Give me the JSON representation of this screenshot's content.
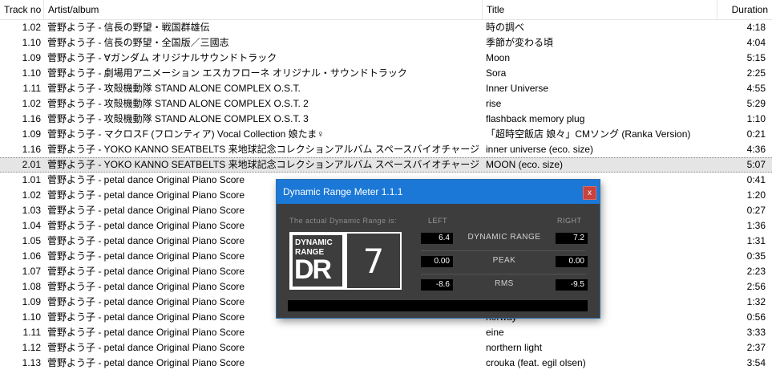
{
  "columns": {
    "track": "Track no",
    "artist": "Artist/album",
    "title": "Title",
    "duration": "Duration"
  },
  "rows": [
    {
      "track": "1.02",
      "artist": "菅野よう子 - 信長の野望・戦国群雄伝",
      "title": "時の調べ",
      "duration": "4:18"
    },
    {
      "track": "1.10",
      "artist": "菅野よう子 - 信長の野望・全国版／三國志",
      "title": "季節が変わる頃",
      "duration": "4:04"
    },
    {
      "track": "1.09",
      "artist": "菅野よう子 - ∀ガンダム オリジナルサウンドトラック",
      "title": "Moon",
      "duration": "5:15"
    },
    {
      "track": "1.10",
      "artist": "菅野よう子 - 劇場用アニメーション エスカフローネ オリジナル・サウンドトラック",
      "title": "Sora",
      "duration": "2:25"
    },
    {
      "track": "1.11",
      "artist": "菅野よう子 - 攻殻機動隊 STAND ALONE COMPLEX O.S.T.",
      "title": "Inner Universe",
      "duration": "4:55"
    },
    {
      "track": "1.02",
      "artist": "菅野よう子 - 攻殻機動隊 STAND ALONE COMPLEX O.S.T. 2",
      "title": "rise",
      "duration": "5:29"
    },
    {
      "track": "1.16",
      "artist": "菅野よう子 - 攻殻機動隊 STAND ALONE COMPLEX O.S.T. 3",
      "title": "flashback memory plug",
      "duration": "1:10"
    },
    {
      "track": "1.09",
      "artist": "菅野よう子 - マクロスF (フロンティア) Vocal Collection 娘たま♀",
      "title": "「超時空飯店 娘々」CMソング (Ranka Version)",
      "duration": "0:21"
    },
    {
      "track": "1.16",
      "artist": "菅野よう子 - YOKO KANNO SEATBELTS 来地球記念コレクションアルバム スペースバイオチャージ",
      "title": "inner universe (eco. size)",
      "duration": "4:36"
    },
    {
      "track": "2.01",
      "artist": "菅野よう子 - YOKO KANNO SEATBELTS 来地球記念コレクションアルバム スペースバイオチャージ",
      "title": "MOON (eco. size)",
      "duration": "5:07",
      "selected": true
    },
    {
      "track": "1.01",
      "artist": "菅野よう子 - petal dance Original Piano Score",
      "title": "",
      "duration": "0:41"
    },
    {
      "track": "1.02",
      "artist": "菅野よう子 - petal dance Original Piano Score",
      "title": "",
      "duration": "1:20"
    },
    {
      "track": "1.03",
      "artist": "菅野よう子 - petal dance Original Piano Score",
      "title": "",
      "duration": "0:27"
    },
    {
      "track": "1.04",
      "artist": "菅野よう子 - petal dance Original Piano Score",
      "title": "",
      "duration": "1:36"
    },
    {
      "track": "1.05",
      "artist": "菅野よう子 - petal dance Original Piano Score",
      "title": "",
      "duration": "1:31"
    },
    {
      "track": "1.06",
      "artist": "菅野よう子 - petal dance Original Piano Score",
      "title": "",
      "duration": "0:35"
    },
    {
      "track": "1.07",
      "artist": "菅野よう子 - petal dance Original Piano Score",
      "title": "",
      "duration": "2:23"
    },
    {
      "track": "1.08",
      "artist": "菅野よう子 - petal dance Original Piano Score",
      "title": "",
      "duration": "2:56"
    },
    {
      "track": "1.09",
      "artist": "菅野よう子 - petal dance Original Piano Score",
      "title": "",
      "duration": "1:32"
    },
    {
      "track": "1.10",
      "artist": "菅野よう子 - petal dance Original Piano Score",
      "title": "norway",
      "duration": "0:56"
    },
    {
      "track": "1.11",
      "artist": "菅野よう子 - petal dance Original Piano Score",
      "title": "eine",
      "duration": "3:33"
    },
    {
      "track": "1.12",
      "artist": "菅野よう子 - petal dance Original Piano Score",
      "title": "northern light",
      "duration": "2:37"
    },
    {
      "track": "1.13",
      "artist": "菅野よう子 - petal dance Original Piano Score",
      "title": "crouka (feat. egil olsen)",
      "duration": "3:54"
    }
  ],
  "dr_window": {
    "title": "Dynamic Range Meter 1.1.1",
    "close_label": "x",
    "subtitle": "The actual Dynamic Range is:",
    "left_label": "LEFT",
    "right_label": "RIGHT",
    "logo_line1": "DYNAMIC",
    "logo_line2": "RANGE",
    "logo_line3": "DR",
    "dr_value": "7",
    "metrics": [
      {
        "name": "DYNAMIC RANGE",
        "left": "6.4",
        "right": "7.2"
      },
      {
        "name": "PEAK",
        "left": "0.00",
        "right": "0.00"
      },
      {
        "name": "RMS",
        "left": "-8.6",
        "right": "-9.5"
      }
    ],
    "colors": {
      "titlebar": "#1b78d6",
      "body": "#3d3d3d",
      "close": "#c9423c"
    }
  }
}
